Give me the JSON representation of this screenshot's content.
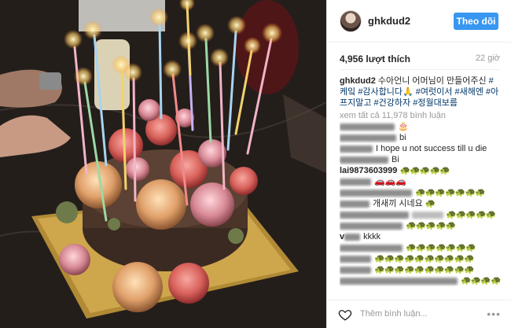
{
  "post": {
    "username": "ghkdud2",
    "follow_label": "Theo dõi",
    "likes": "4,956 lượt thích",
    "time_ago": "22 giờ",
    "caption": {
      "username": "ghkdud2",
      "text": " 수아언니 어머님이 만들어주신 ",
      "tags": [
        "#케잌",
        "#감사합니다🙏",
        "#여럿이서",
        "#새해엔",
        "#아프지말고",
        "#건강하자",
        "#정월대보름"
      ]
    },
    "view_all": "xem tất cả 11,978 bình luận",
    "comments": [
      {
        "user": "",
        "text": "🎂"
      },
      {
        "user": "",
        "text": "bi"
      },
      {
        "user": "",
        "text": "I hope u not success till u die"
      },
      {
        "user": "",
        "text": "Bi"
      },
      {
        "user": "lai9873603999",
        "text": "🐢🐢🐢🐢🐢"
      },
      {
        "user": "",
        "text": "🚗🚗🚗"
      },
      {
        "user": "",
        "text": "🐢🐢🐢🐢🐢🐢🐢"
      },
      {
        "user": "",
        "text": "개새끼 시네요 🐢"
      },
      {
        "user": "",
        "text": "🐢🐢🐢🐢🐢"
      },
      {
        "user": "",
        "text": "🐢🐢🐢🐢🐢"
      },
      {
        "user": "v",
        "text": "kkkk"
      },
      {
        "user": "",
        "text": "🐢🐢🐢🐢🐢🐢🐢"
      },
      {
        "user": "",
        "text": "🐢🐢🐢🐢🐢🐢🐢🐢🐢🐢"
      },
      {
        "user": "",
        "text": "🐢🐢🐢🐢🐢🐢🐢🐢🐢🐢"
      },
      {
        "user": "",
        "text": "🐢🐢🐢🐢"
      }
    ],
    "add_comment_placeholder": "Thêm bình luận...",
    "more_icon": "•••"
  },
  "colors": {
    "accent": "#3897f0",
    "hashtag": "#003569"
  }
}
